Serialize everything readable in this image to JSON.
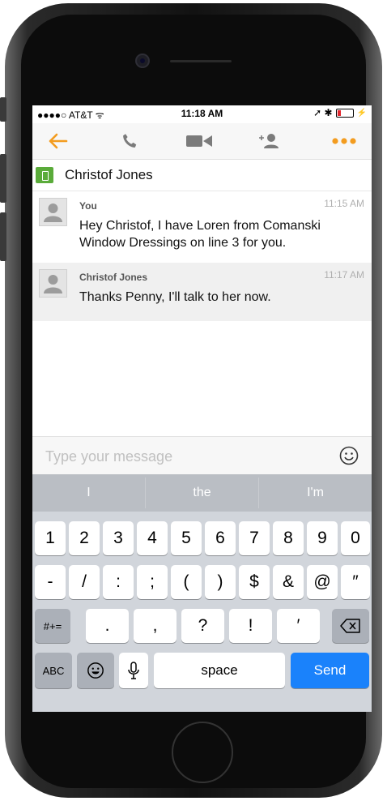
{
  "status_bar": {
    "carrier": "●●●●○ AT&T ᯤ",
    "time": "11:18 AM",
    "right_glyphs": "➚ ✱"
  },
  "toolbar": {
    "icons": [
      "back-arrow-icon",
      "phone-icon",
      "video-camera-icon",
      "add-contact-icon",
      "more-icon"
    ],
    "accent_color": "#f39c1f"
  },
  "contact": {
    "name": "Christof Jones"
  },
  "messages": [
    {
      "sender": "You",
      "time": "11:15 AM",
      "text": "Hey Christof, I have Loren from Comanski Window Dressings on line 3 for you."
    },
    {
      "sender": "Christof Jones",
      "time": "11:17 AM",
      "text": "Thanks Penny, I'll talk to her now."
    }
  ],
  "compose": {
    "placeholder": "Type your message"
  },
  "keyboard": {
    "suggestions": [
      "I",
      "the",
      "I'm"
    ],
    "row1": [
      "1",
      "2",
      "3",
      "4",
      "5",
      "6",
      "7",
      "8",
      "9",
      "0"
    ],
    "row2": [
      "-",
      "/",
      ":",
      ";",
      "(",
      ")",
      "$",
      "&",
      "@",
      "″"
    ],
    "row3": {
      "shift_label": "#+=",
      "keys": [
        ".",
        ",",
        "?",
        "!",
        "′"
      ]
    },
    "row4": {
      "abc_label": "ABC",
      "space_label": "space",
      "send_label": "Send"
    },
    "send_color": "#1a82fb"
  }
}
